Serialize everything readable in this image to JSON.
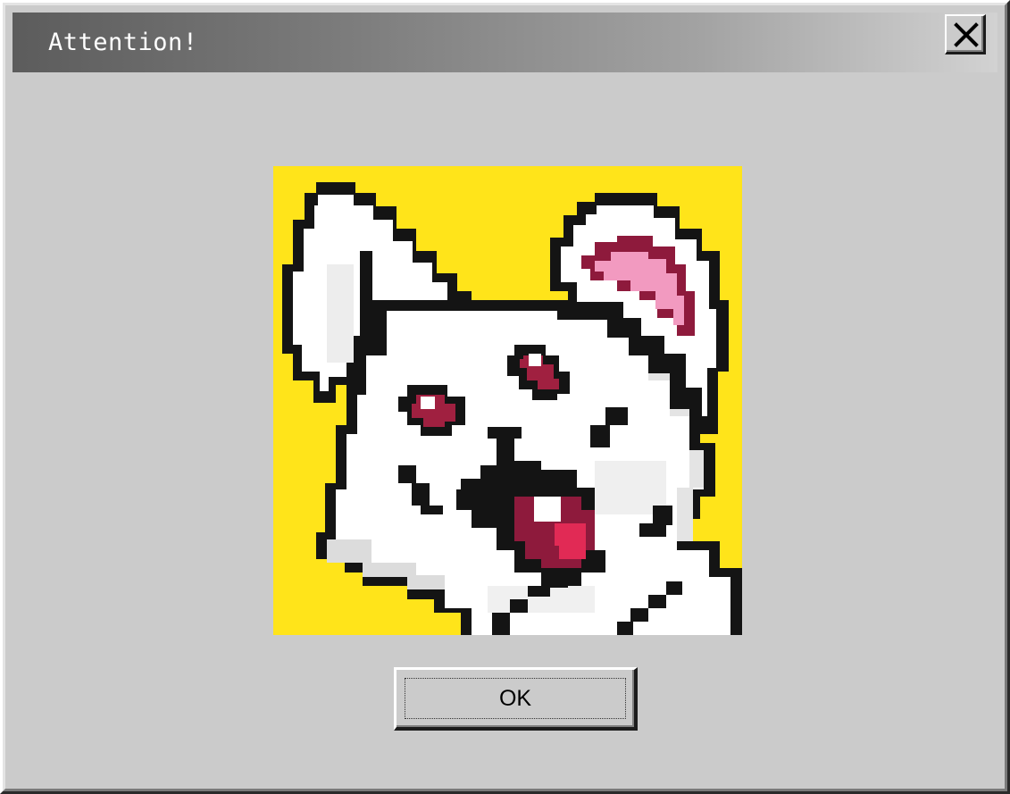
{
  "window": {
    "title": "Attention!"
  },
  "titlebar": {
    "close_icon": "close-icon"
  },
  "content": {
    "image": "pixel-art-white-rabbit",
    "image_background": "#ffe41a"
  },
  "buttons": {
    "ok_label": "OK"
  },
  "colors": {
    "dialog_face": "#cbcbcb",
    "titlebar_start": "#5c5c5c",
    "titlebar_end": "#d2d2d2",
    "title_text": "#ffffff"
  }
}
